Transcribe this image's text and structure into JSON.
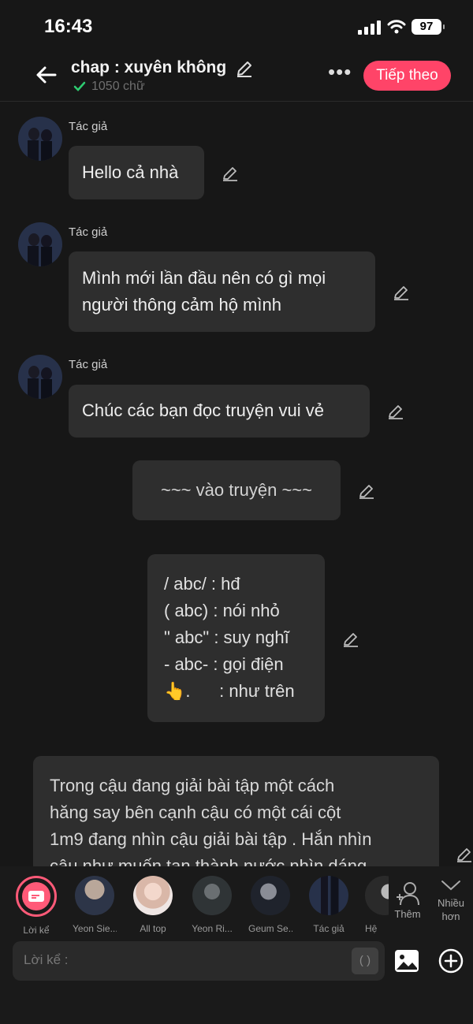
{
  "status": {
    "time": "16:43",
    "battery": "97"
  },
  "header": {
    "title": "chap : xuyên không",
    "word_count": "1050 chữ",
    "more": "•••",
    "next_label": "Tiếp theo"
  },
  "messages": [
    {
      "author": "Tác giả",
      "text": "Hello cả nhà"
    },
    {
      "author": "Tác giả",
      "lines": [
        "Mình mới lần đầu nên có gì mọi",
        "người thông cảm hộ mình"
      ]
    },
    {
      "author": "Tác giả",
      "text": "Chúc các bạn đọc truyện vui vẻ"
    },
    {
      "text": "~~~ vào truyện ~~~"
    },
    {
      "lines": [
        "/ abc/ : hđ",
        "( abc) : nói nhỏ",
        "\" abc\" : suy nghĩ",
        "- abc- : gọi điện",
        "👆.      : như trên"
      ]
    },
    {
      "lines": [
        "Trong cậu đang giải bài tập một cách",
        "hăng say bên cạnh cậu có một cái cột",
        "1m9 đang nhìn cậu giải bài tập . Hắn nhìn",
        "cậu như muốn tan thành nước nhìn dáng"
      ]
    }
  ],
  "characters": [
    {
      "label": "Lời kể",
      "icon": "narration-icon"
    },
    {
      "label": "Yeon Sie..."
    },
    {
      "label": "All top"
    },
    {
      "label": "Yeon Ri..."
    },
    {
      "label": "Geum Se..."
    },
    {
      "label": "Tác giả"
    },
    {
      "label": "Hệ"
    }
  ],
  "toolbar": {
    "add_label": "Thêm",
    "more_label_1": "Nhiều",
    "more_label_2": "hơn",
    "input_placeholder": "Lời kể :",
    "bracket_label": "( )"
  },
  "colors": {
    "accent": "#ff4468",
    "bubble": "#2e2e2e",
    "background": "#171717"
  }
}
